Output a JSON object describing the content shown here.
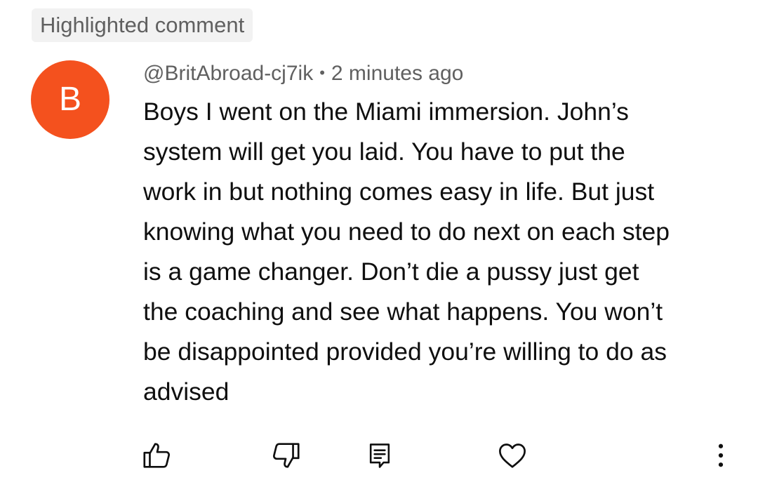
{
  "highlight_label": "Highlighted comment",
  "comment": {
    "avatar_letter": "B",
    "avatar_color": "#f4511e",
    "author": "@BritAbroad-cj7ik",
    "separator": "•",
    "timestamp": "2 minutes ago",
    "text_lines": [
      "Boys I went on the Miami immersion. John’s",
      "system will get you laid. You have to put the",
      "work in but nothing comes easy in life. But just",
      "knowing what you need to do next on each step",
      "is a game changer. Don’t die a pussy just get",
      "the coaching and see what happens. You won’t",
      "be disappointed provided you’re willing to do as",
      "advised"
    ]
  },
  "actions": {
    "like_icon": "thumbs-up-icon",
    "dislike_icon": "thumbs-down-icon",
    "reply_icon": "comment-icon",
    "heart_icon": "heart-icon",
    "more_icon": "more-vertical-icon"
  }
}
